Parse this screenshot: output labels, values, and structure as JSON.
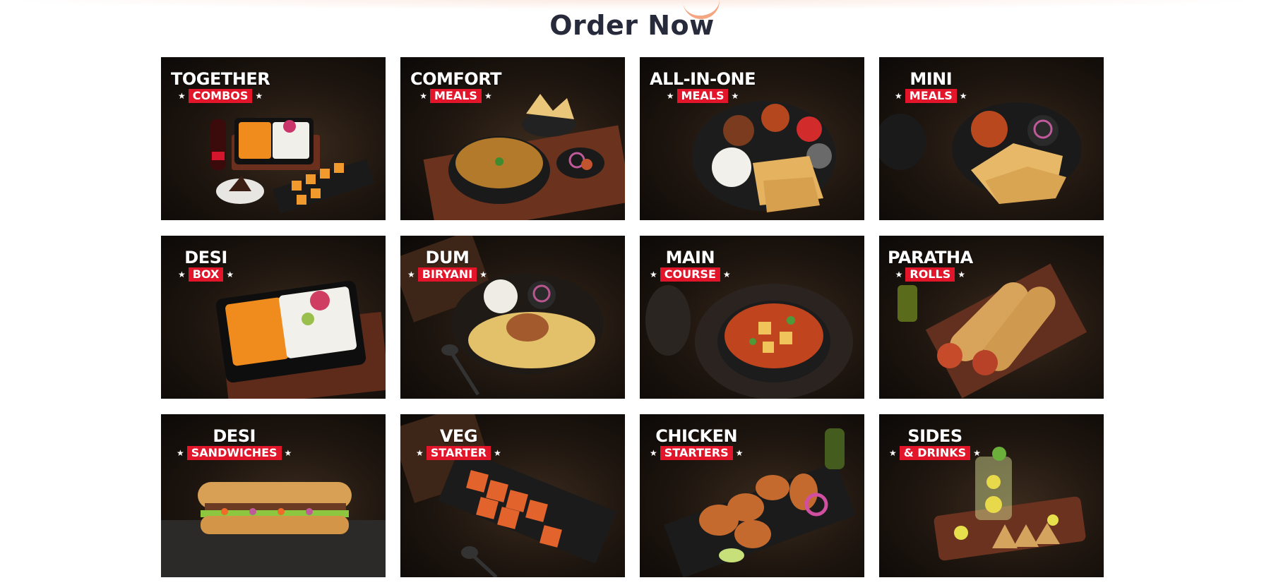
{
  "section_title": "Order Now",
  "categories": [
    {
      "title": "TOGETHER",
      "tag": "COMBOS",
      "image": "combo-meal-photo"
    },
    {
      "title": "COMFORT",
      "tag": "MEALS",
      "image": "dal-bowl-photo"
    },
    {
      "title": "ALL-IN-ONE",
      "tag": "MEALS",
      "image": "thali-photo"
    },
    {
      "title": "MINI",
      "tag": "MEALS",
      "image": "paratha-curry-photo"
    },
    {
      "title": "DESI",
      "tag": "BOX",
      "image": "rice-curry-box-photo"
    },
    {
      "title": "DUM",
      "tag": "BIRYANI",
      "image": "biryani-photo"
    },
    {
      "title": "MAIN",
      "tag": "COURSE",
      "image": "paneer-curry-photo"
    },
    {
      "title": "PARATHA",
      "tag": "ROLLS",
      "image": "wrap-rolls-photo"
    },
    {
      "title": "DESI",
      "tag": "SANDWICHES",
      "image": "sub-sandwich-photo"
    },
    {
      "title": "VEG",
      "tag": "STARTER",
      "image": "paneer-tikka-photo"
    },
    {
      "title": "CHICKEN",
      "tag": "STARTERS",
      "image": "chicken-tikka-photo"
    },
    {
      "title": "SIDES",
      "tag": "& DRINKS",
      "image": "samosa-lemonade-photo"
    }
  ]
}
